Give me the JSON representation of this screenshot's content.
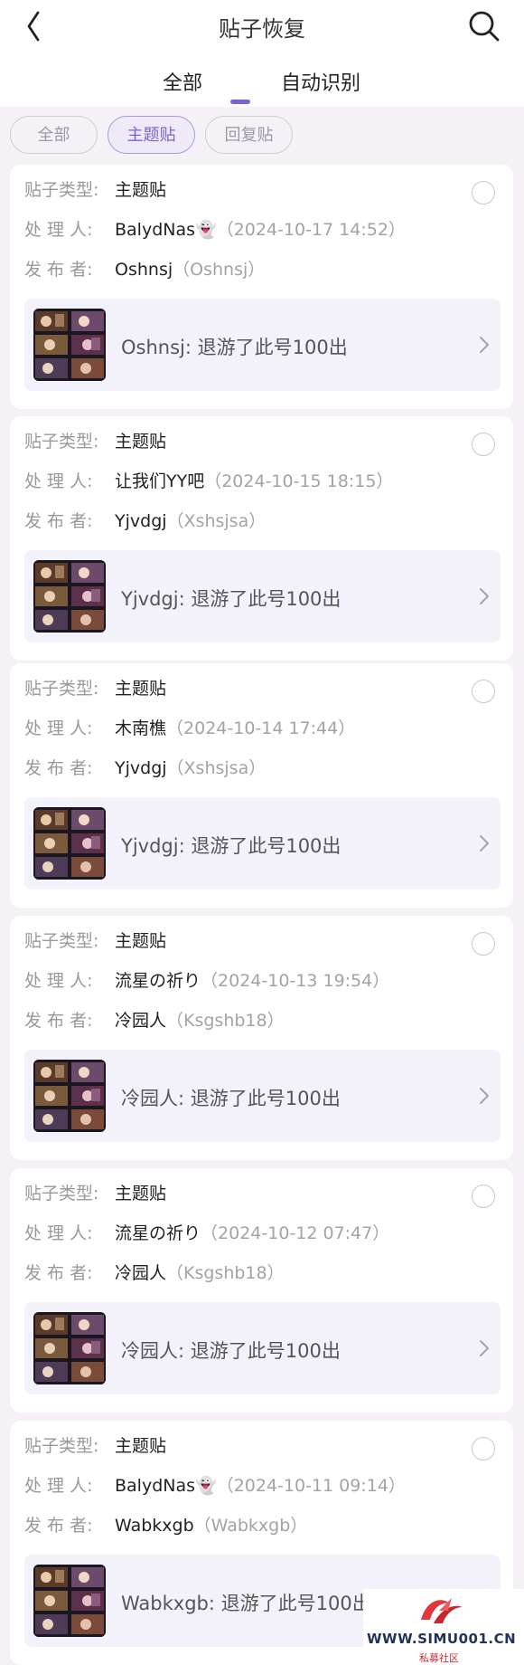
{
  "header": {
    "title": "贴子恢复",
    "back_icon": "chevron-left-icon",
    "search_icon": "search-icon",
    "tabs": [
      {
        "label": "全部",
        "active": true
      },
      {
        "label": "自动识别",
        "active": false
      }
    ],
    "accent": "#7b63cf"
  },
  "filters": [
    {
      "label": "全部",
      "active": false
    },
    {
      "label": "主题贴",
      "active": true
    },
    {
      "label": "回复贴",
      "active": false
    }
  ],
  "labels": {
    "type": "贴子类型:",
    "handler": "处 理 人:",
    "poster": "发 布 者:"
  },
  "cards": [
    {
      "type": "主题贴",
      "handler": "BalydNas👻",
      "time": "（2024-10-17 14:52）",
      "poster": "Oshnsj",
      "poster_id": "（Oshnsj）",
      "post_text": "Oshnsj: 退游了此号100出"
    },
    {
      "type": "主题贴",
      "handler": "让我们YY吧",
      "time": "（2024-10-15 18:15）",
      "poster": "Yjvdgj",
      "poster_id": "（Xshsjsa）",
      "post_text": "Yjvdgj: 退游了此号100出"
    },
    {
      "type": "主题贴",
      "handler": "木南樵",
      "time": "（2024-10-14 17:44）",
      "poster": "Yjvdgj",
      "poster_id": "（Xshsjsa）",
      "post_text": "Yjvdgj: 退游了此号100出"
    },
    {
      "type": "主题贴",
      "handler": "流星の祈り",
      "time": "（2024-10-13 19:54）",
      "poster": "冷园人",
      "poster_id": "（Ksgshb18）",
      "post_text": "冷园人: 退游了此号100出"
    },
    {
      "type": "主题贴",
      "handler": "流星の祈り",
      "time": "（2024-10-12 07:47）",
      "poster": "冷园人",
      "poster_id": "（Ksgshb18）",
      "post_text": "冷园人: 退游了此号100出"
    },
    {
      "type": "主题贴",
      "handler": "BalydNas👻",
      "time": "（2024-10-11 09:14）",
      "poster": "Wabkxgb",
      "poster_id": "（Wabkxgb）",
      "post_text": "Wabkxgb: 退游了此号100出"
    }
  ],
  "watermark": {
    "site": "WWW.SIMU001.CN",
    "name": "私募社区"
  }
}
